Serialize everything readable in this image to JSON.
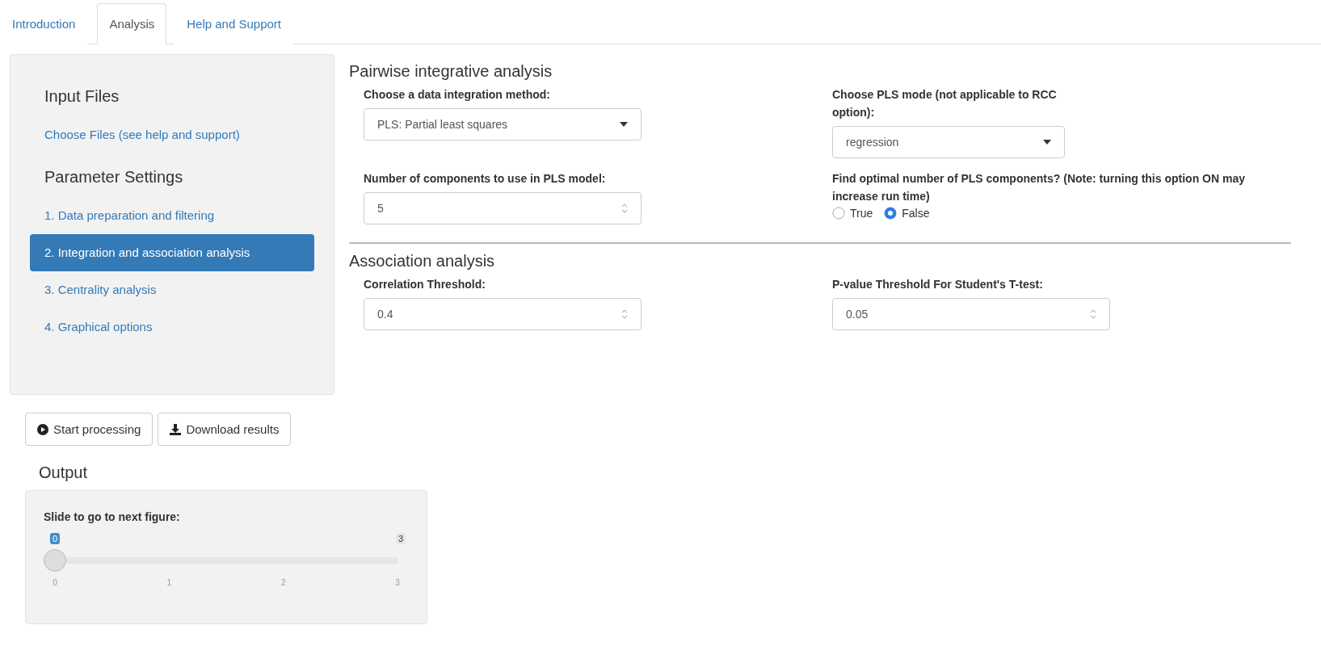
{
  "tabs": [
    {
      "label": "Introduction",
      "selected": false
    },
    {
      "label": "Analysis",
      "selected": true
    },
    {
      "label": "Help and Support",
      "selected": false
    }
  ],
  "sidebar": {
    "sections": [
      {
        "heading": "Input Files",
        "items": [
          {
            "label": "Choose Files (see help and support)",
            "selected": false
          }
        ]
      },
      {
        "heading": "Parameter Settings",
        "items": [
          {
            "label": "1. Data preparation and filtering",
            "selected": false
          },
          {
            "label": "2. Integration and association analysis",
            "selected": true
          },
          {
            "label": "3. Centrality analysis",
            "selected": false
          },
          {
            "label": "4. Graphical options",
            "selected": false
          }
        ]
      }
    ]
  },
  "actions": [
    {
      "kind": "start",
      "label": "Start processing"
    },
    {
      "kind": "download",
      "label": "Download results"
    }
  ],
  "output": {
    "heading": "Output",
    "slider": {
      "label": "Slide to go to next figure:",
      "value": "0",
      "max": "3",
      "level": 0,
      "ticks": [
        "0",
        "1",
        "2",
        "3"
      ]
    }
  },
  "sections": [
    {
      "title": "Pairwise integrative analysis",
      "fields": [
        {
          "kind": "select",
          "label": "Choose a data integration method:",
          "value": "PLS: Partial least squares"
        },
        {
          "kind": "select",
          "label": "Choose PLS mode (not applicable to RCC option):",
          "value": "regression"
        },
        {
          "kind": "number",
          "label": "Number of components to use in PLS model:",
          "value": "5"
        },
        {
          "kind": "radio",
          "label": "Find optimal number of PLS components? (Note: turning this option ON may increase run time)",
          "options": [
            {
              "label": "True",
              "selected": false
            },
            {
              "label": "False",
              "selected": true
            }
          ]
        }
      ]
    },
    {
      "title": "Association analysis",
      "fields": [
        {
          "kind": "number",
          "label": "Correlation Threshold:",
          "value": "0.4"
        },
        {
          "kind": "number",
          "label": "P-value Threshold For Student's T-test:",
          "value": "0.05"
        }
      ]
    }
  ]
}
